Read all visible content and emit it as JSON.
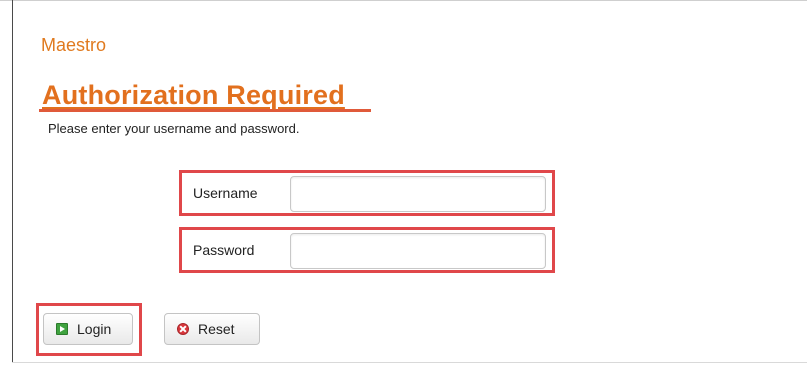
{
  "brand": {
    "name": "Maestro"
  },
  "auth": {
    "heading": "Authorization Required",
    "instructions": "Please enter your username and password."
  },
  "form": {
    "username": {
      "label": "Username",
      "value": "",
      "placeholder": ""
    },
    "password": {
      "label": "Password",
      "value": "",
      "placeholder": ""
    }
  },
  "buttons": {
    "login_label": "Login",
    "login_icon": "play-icon",
    "reset_label": "Reset",
    "reset_icon": "close-icon"
  },
  "colors": {
    "accent": "#e2701e",
    "highlight_border": "#e0474a"
  }
}
